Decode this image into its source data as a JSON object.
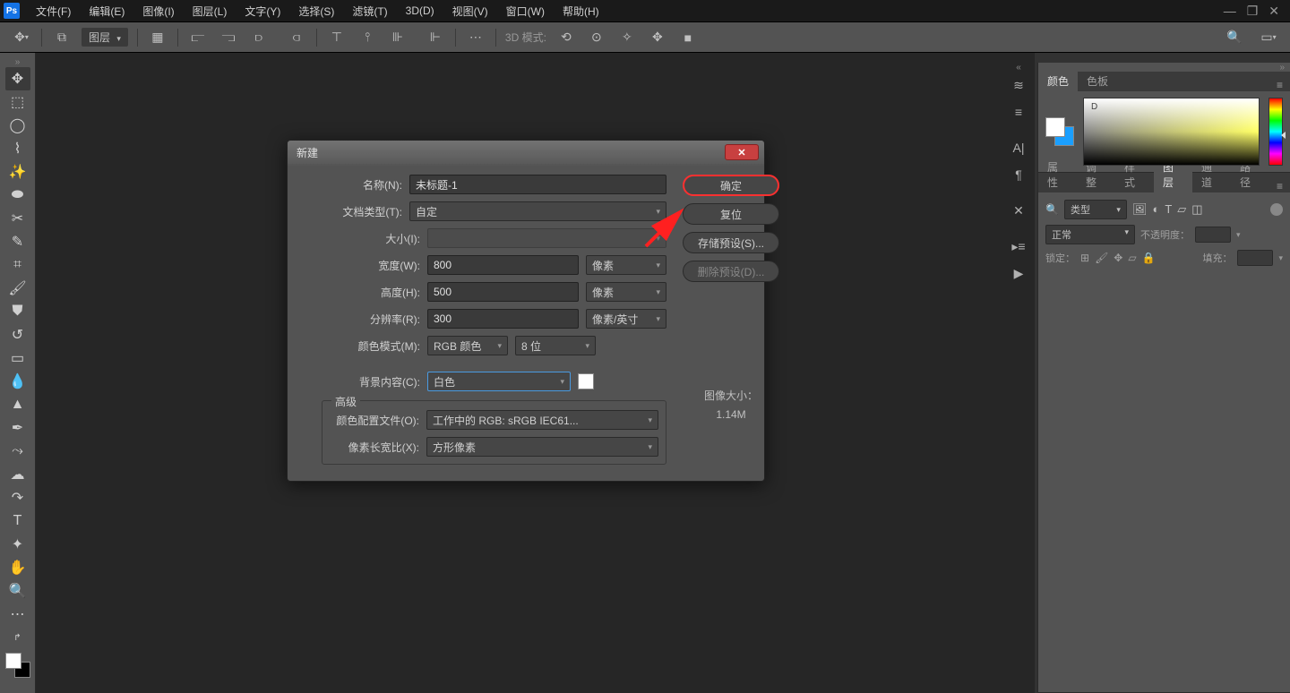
{
  "menubar": {
    "logo": "Ps",
    "items": [
      "文件(F)",
      "编辑(E)",
      "图像(I)",
      "图层(L)",
      "文字(Y)",
      "选择(S)",
      "滤镜(T)",
      "3D(D)",
      "视图(V)",
      "窗口(W)",
      "帮助(H)"
    ]
  },
  "optionsbar": {
    "layer_label": "图层",
    "mode_3d_label": "3D 模式:"
  },
  "right_panels": {
    "color_tabs": [
      "颜色",
      "色板"
    ],
    "color_cursor": "D",
    "layer_group_tabs": [
      "属性",
      "调整",
      "样式",
      "图层",
      "通道",
      "路径"
    ],
    "layer_active_tab": 3,
    "layer_search_kind": "类型",
    "blend_mode": "正常",
    "opacity_label": "不透明度：",
    "lock_label": "锁定：",
    "fill_label": "填充："
  },
  "dialog": {
    "title": "新建",
    "name_label": "名称(N):",
    "name_value": "未标题-1",
    "doc_type_label": "文档类型(T):",
    "doc_type_value": "自定",
    "size_label": "大小(I):",
    "width_label": "宽度(W):",
    "width_value": "800",
    "width_unit": "像素",
    "height_label": "高度(H):",
    "height_value": "500",
    "height_unit": "像素",
    "resolution_label": "分辨率(R):",
    "resolution_value": "300",
    "resolution_unit": "像素/英寸",
    "color_mode_label": "颜色模式(M):",
    "color_mode_value": "RGB 颜色",
    "color_depth_value": "8 位",
    "bg_label": "背景内容(C):",
    "bg_value": "白色",
    "advanced_legend": "高级",
    "profile_label": "颜色配置文件(O):",
    "profile_value": "工作中的 RGB: sRGB IEC61...",
    "aspect_label": "像素长宽比(X):",
    "aspect_value": "方形像素",
    "btn_ok": "确定",
    "btn_reset": "复位",
    "btn_save_preset": "存储预设(S)...",
    "btn_delete_preset": "删除预设(D)...",
    "image_size_label": "图像大小：",
    "image_size_value": "1.14M"
  }
}
